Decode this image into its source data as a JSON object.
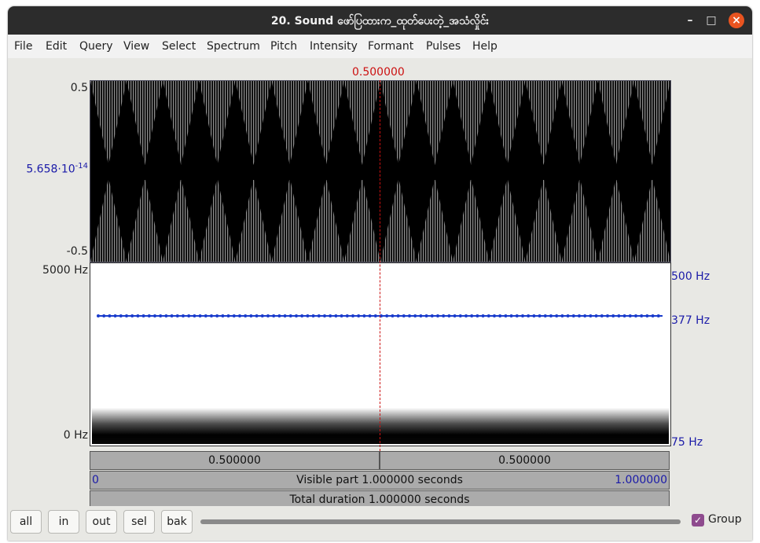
{
  "window": {
    "title": "20. Sound ဖော်ပြထားက_ထုတ်ပေးတဲ့_အသံလှိုင်း",
    "controls": [
      "–",
      "□",
      "×"
    ]
  },
  "menu": [
    "File",
    "Edit",
    "Query",
    "View",
    "Select",
    "Spectrum",
    "Pitch",
    "Intensity",
    "Formant",
    "Pulses",
    "Help"
  ],
  "waveform": {
    "cursor_time": "0.500000",
    "y_top": "0.5",
    "y_mid_mantissa": "5.658·10",
    "y_mid_exponent": "-14",
    "y_bottom": "-0.5"
  },
  "spectrogram": {
    "freq_top": "5000 Hz",
    "freq_bottom": "0 Hz",
    "pitch_top": "500 Hz",
    "pitch_value": "377 Hz",
    "pitch_bottom": "75 Hz"
  },
  "time_bars": {
    "left_segment": "0.500000",
    "right_segment": "0.500000",
    "visible_start": "0",
    "visible_label": "Visible part 1.000000 seconds",
    "visible_end": "1.000000",
    "total_label": "Total duration 1.000000 seconds"
  },
  "buttons": {
    "all": "all",
    "in": "in",
    "out": "out",
    "sel": "sel",
    "bak": "bak"
  },
  "group": {
    "label": "Group",
    "checked": true
  },
  "icons": {
    "minimize": "minimize-icon",
    "maximize": "maximize-icon",
    "close": "close-icon",
    "checkbox": "checkmark-icon"
  },
  "colors": {
    "cursor": "#cc1010",
    "axis_blue": "#1a1aa8",
    "close_button": "#e95420",
    "checkbox": "#8e4b8e"
  }
}
